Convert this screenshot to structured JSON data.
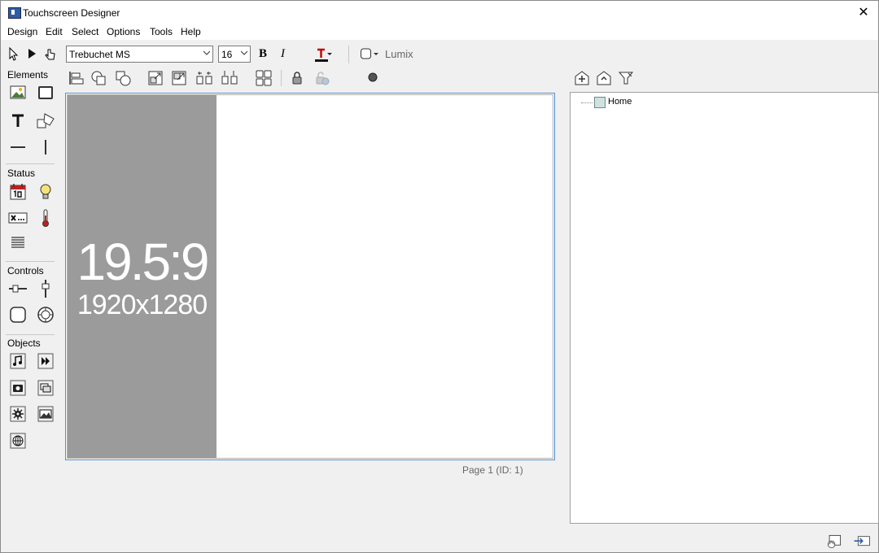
{
  "window": {
    "title": "Touchscreen Designer",
    "close_glyph": "✕"
  },
  "menu": [
    "Design",
    "Edit",
    "Select",
    "Options",
    "Tools",
    "Help"
  ],
  "toolbar": {
    "font_name": "Trebuchet MS",
    "font_size": "16",
    "bold_label": "B",
    "italic_label": "I",
    "theme_label": "Lumix",
    "accent_color": "#c00000"
  },
  "palette": {
    "elements_label": "Elements",
    "status_label": "Status",
    "controls_label": "Controls",
    "objects_label": "Objects"
  },
  "canvas": {
    "ratio": "19.5:9",
    "resolution": "1920x1280",
    "page_label": "Page 1  (ID: 1)"
  },
  "tree": {
    "root_label": "Home"
  }
}
